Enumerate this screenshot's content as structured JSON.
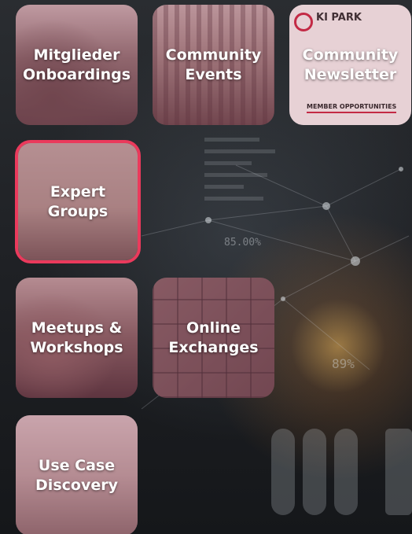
{
  "tiles": [
    {
      "label": "Mitglieder Onboardings",
      "selected": false
    },
    {
      "label": "Community Events",
      "selected": false
    },
    {
      "label": "Community Newsletter",
      "selected": false,
      "logo": "KI PARK",
      "badge": "MEMBER OPPORTUNITIES"
    },
    {
      "label": "Expert Groups",
      "selected": true
    },
    {
      "label": "Meetups & Workshops",
      "selected": false
    },
    {
      "label": "Online Exchanges",
      "selected": false
    },
    {
      "label": "Use Case Discovery",
      "selected": false
    }
  ],
  "background": {
    "readout_1": "85.00%",
    "readout_2": "89%"
  },
  "colors": {
    "selected_border": "#ea3a5c",
    "tile_tint": "#963c5a",
    "brand_red": "#c8243f"
  }
}
